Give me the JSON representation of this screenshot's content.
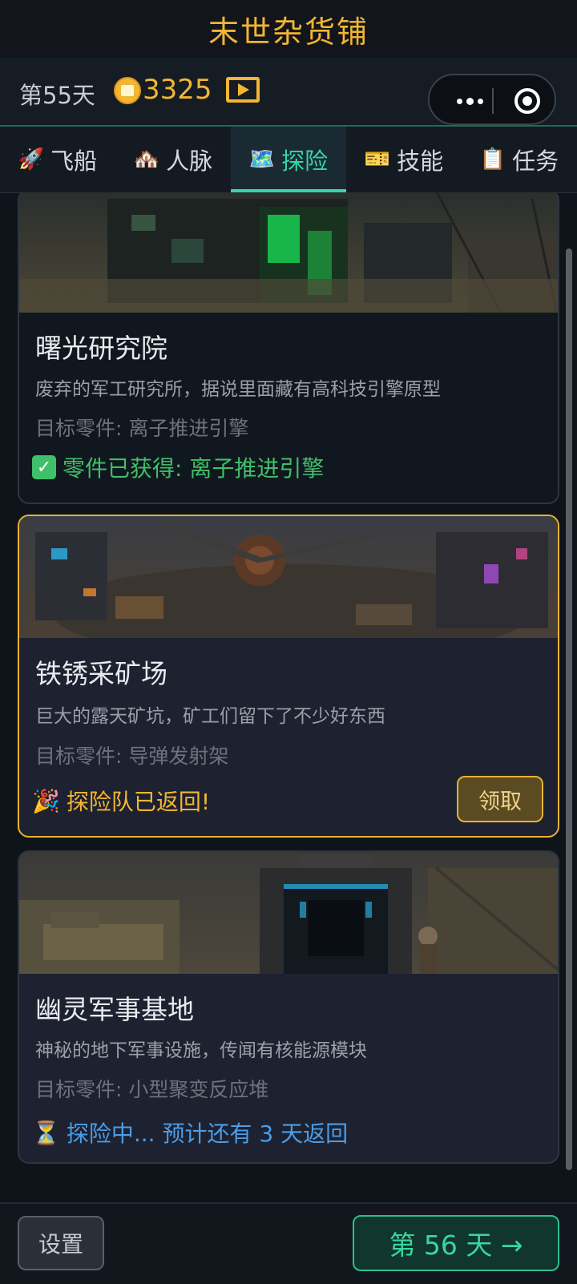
{
  "app": {
    "title": "末世杂货铺"
  },
  "status": {
    "day": "第55天",
    "gold": "3325"
  },
  "tabs": [
    {
      "emoji": "🚀",
      "label": "飞船"
    },
    {
      "emoji": "🏘️",
      "label": "人脉"
    },
    {
      "emoji": "🗺️",
      "label": "探险"
    },
    {
      "emoji": "🎫",
      "label": "技能"
    },
    {
      "emoji": "📋",
      "label": "任务"
    }
  ],
  "active_tab": "探险",
  "expeditions": [
    {
      "name": "曙光研究院",
      "desc": "废弃的军工研究所，据说里面藏有高科技引擎原型",
      "target": "目标零件: 离子推进引擎",
      "status": "零件已获得: 离子推进引擎"
    },
    {
      "name": "铁锈采矿场",
      "desc": "巨大的露天矿坑，矿工们留下了不少好东西",
      "target": "目标零件: 导弹发射架",
      "status": "探险队已返回!",
      "status_emoji": "🎉",
      "action": "领取"
    },
    {
      "name": "幽灵军事基地",
      "desc": "神秘的地下军事设施，传闻有核能源模块",
      "target": "目标零件: 小型聚变反应堆",
      "status": "探险中... 预计还有 3 天返回",
      "status_emoji": "⏳"
    }
  ],
  "footer": {
    "settings": "设置",
    "next_day": "第 56 天 →"
  },
  "colors": {
    "accent_gold": "#f2b632",
    "accent_green": "#35d6a4",
    "done_green": "#3fbf6a",
    "progress_blue": "#4a9de8"
  }
}
